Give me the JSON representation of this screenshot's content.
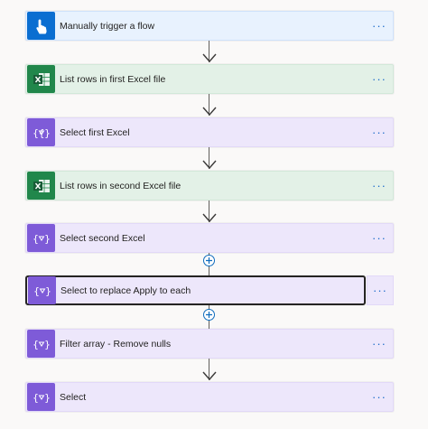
{
  "steps": [
    {
      "title": "Manually trigger a flow",
      "kind": "trigger",
      "icon": "hand-pointer-icon",
      "more": "···"
    },
    {
      "title": "List rows in first Excel file",
      "kind": "excel",
      "icon": "excel-icon",
      "more": "···"
    },
    {
      "title": "Select first Excel",
      "kind": "data",
      "icon": "data-operation-icon",
      "more": "···"
    },
    {
      "title": "List rows in second Excel file",
      "kind": "excel",
      "icon": "excel-icon",
      "more": "···"
    },
    {
      "title": "Select second Excel",
      "kind": "data",
      "icon": "data-operation-icon",
      "more": "···"
    },
    {
      "title": "Select to replace Apply to each",
      "kind": "data",
      "icon": "data-operation-icon",
      "more": "···",
      "selected": true
    },
    {
      "title": "Filter array - Remove nulls",
      "kind": "data",
      "icon": "data-operation-icon",
      "more": "···"
    },
    {
      "title": "Select",
      "kind": "data",
      "icon": "data-operation-icon",
      "more": "···"
    }
  ],
  "colors": {
    "trigger_accent": "#0a6ed1",
    "excel_accent": "#21874b",
    "data_accent": "#7e5bd8",
    "link_blue": "#1b6ac9"
  }
}
